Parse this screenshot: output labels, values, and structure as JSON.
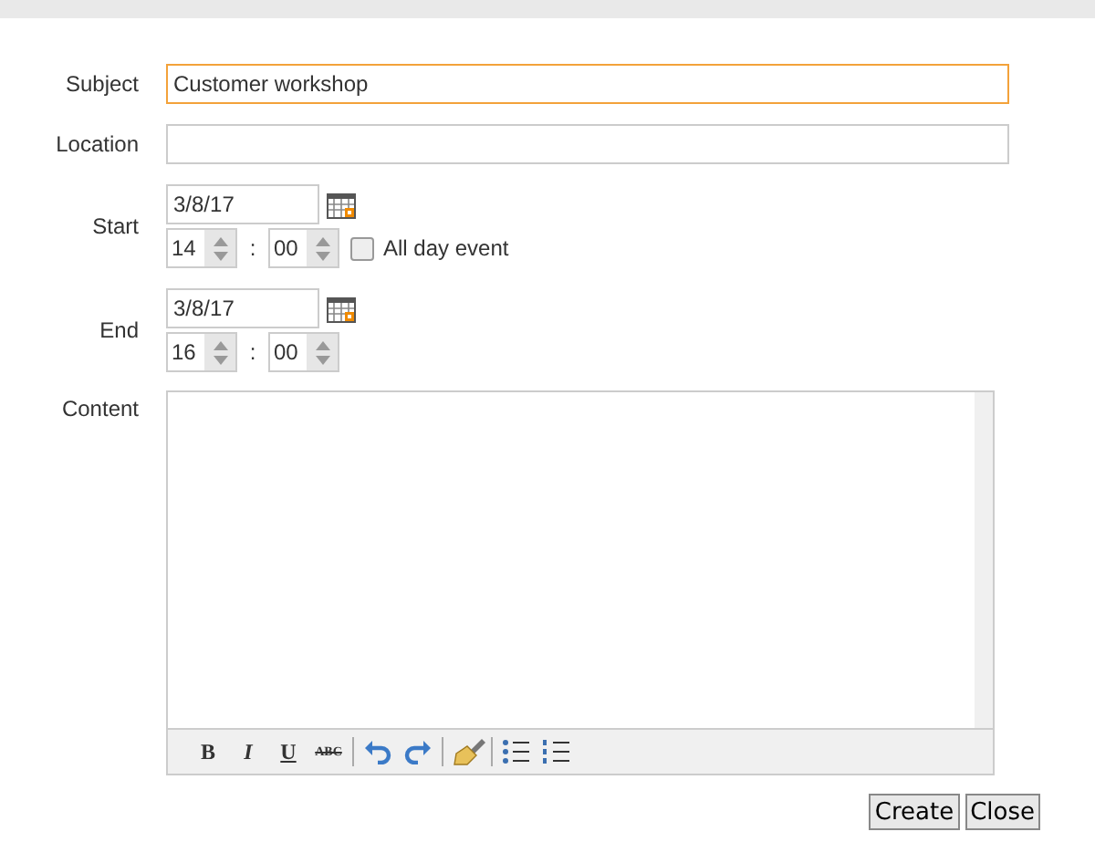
{
  "subject": {
    "label": "Subject",
    "value": "Customer workshop",
    "focused": true
  },
  "location": {
    "label": "Location"
  },
  "start": {
    "label": "Start",
    "date": "3/8/17",
    "hour": "14",
    "separator": ":",
    "minute": "00",
    "all_day": {
      "label": "All day event",
      "checked": false
    }
  },
  "end": {
    "label": "End",
    "date": "3/8/17",
    "hour": "16",
    "separator": ":",
    "minute": "00"
  },
  "content": {
    "label": "Content",
    "toolbar": [
      {
        "kind": "bold",
        "text": "B"
      },
      {
        "kind": "italic",
        "text": "I"
      },
      {
        "kind": "underline",
        "text": "U"
      },
      {
        "kind": "strike",
        "text": "ABC"
      },
      {
        "kind": "divider"
      },
      {
        "kind": "undo"
      },
      {
        "kind": "redo"
      },
      {
        "kind": "divider"
      },
      {
        "kind": "clean"
      },
      {
        "kind": "divider"
      },
      {
        "kind": "bullets"
      },
      {
        "kind": "numbers"
      }
    ]
  },
  "buttons": [
    "Create",
    "Close"
  ]
}
